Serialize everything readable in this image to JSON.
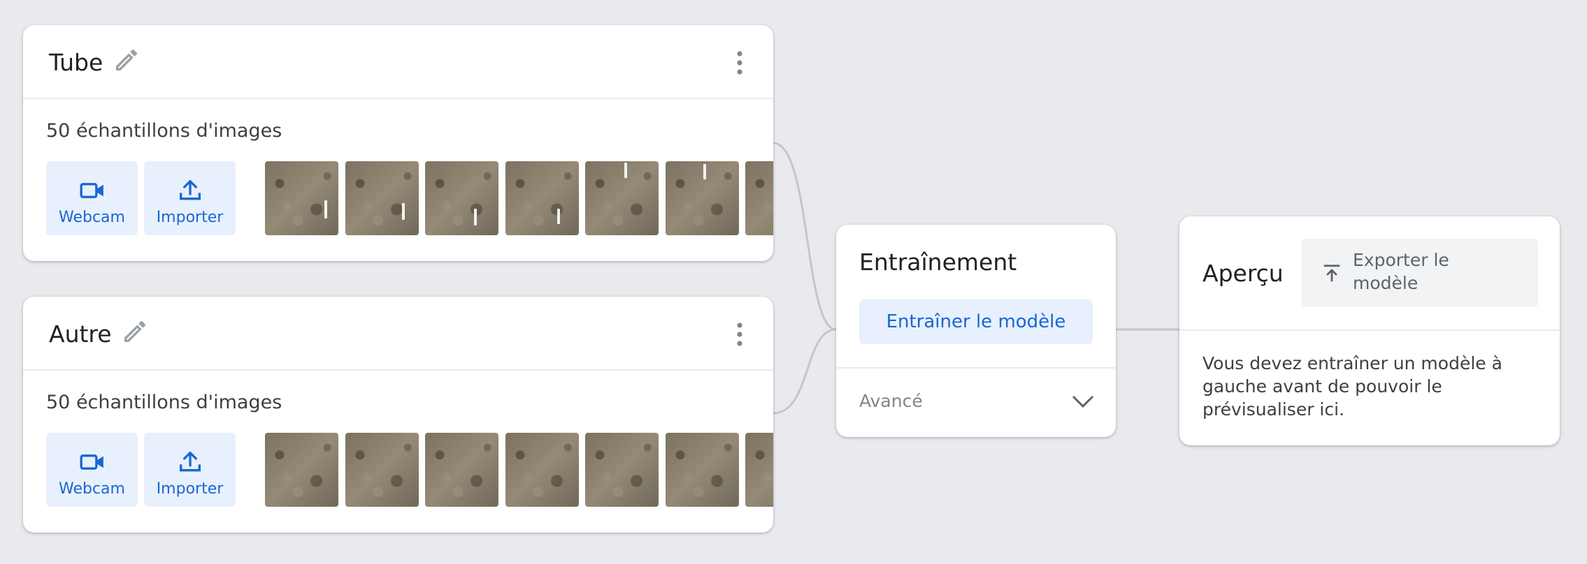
{
  "colors": {
    "background": "#e8eaed",
    "card": "#ffffff",
    "accent": "#1967d2",
    "button_tint": "#e8f0fe",
    "muted_text": "#80868b",
    "thumbnail_ground": "#857b69"
  },
  "classes": [
    {
      "name": "Tube",
      "sample_count": "50 échantillons d'images",
      "webcam_label": "Webcam",
      "import_label": "Importer",
      "edit_icon": "pencil-icon",
      "menu_icon": "more-vert-icon"
    },
    {
      "name": "Autre",
      "sample_count": "50 échantillons d'images",
      "webcam_label": "Webcam",
      "import_label": "Importer",
      "edit_icon": "pencil-icon",
      "menu_icon": "more-vert-icon"
    }
  ],
  "training": {
    "title": "Entraînement",
    "train_button": "Entraîner le modèle",
    "advanced_label": "Avancé",
    "advanced_icon": "chevron-down-icon"
  },
  "preview": {
    "title": "Aperçu",
    "export_button": "Exporter le modèle",
    "export_icon": "upload-icon",
    "message": "Vous devez entraîner un modèle à gauche avant de pouvoir le prévisualiser ici."
  }
}
